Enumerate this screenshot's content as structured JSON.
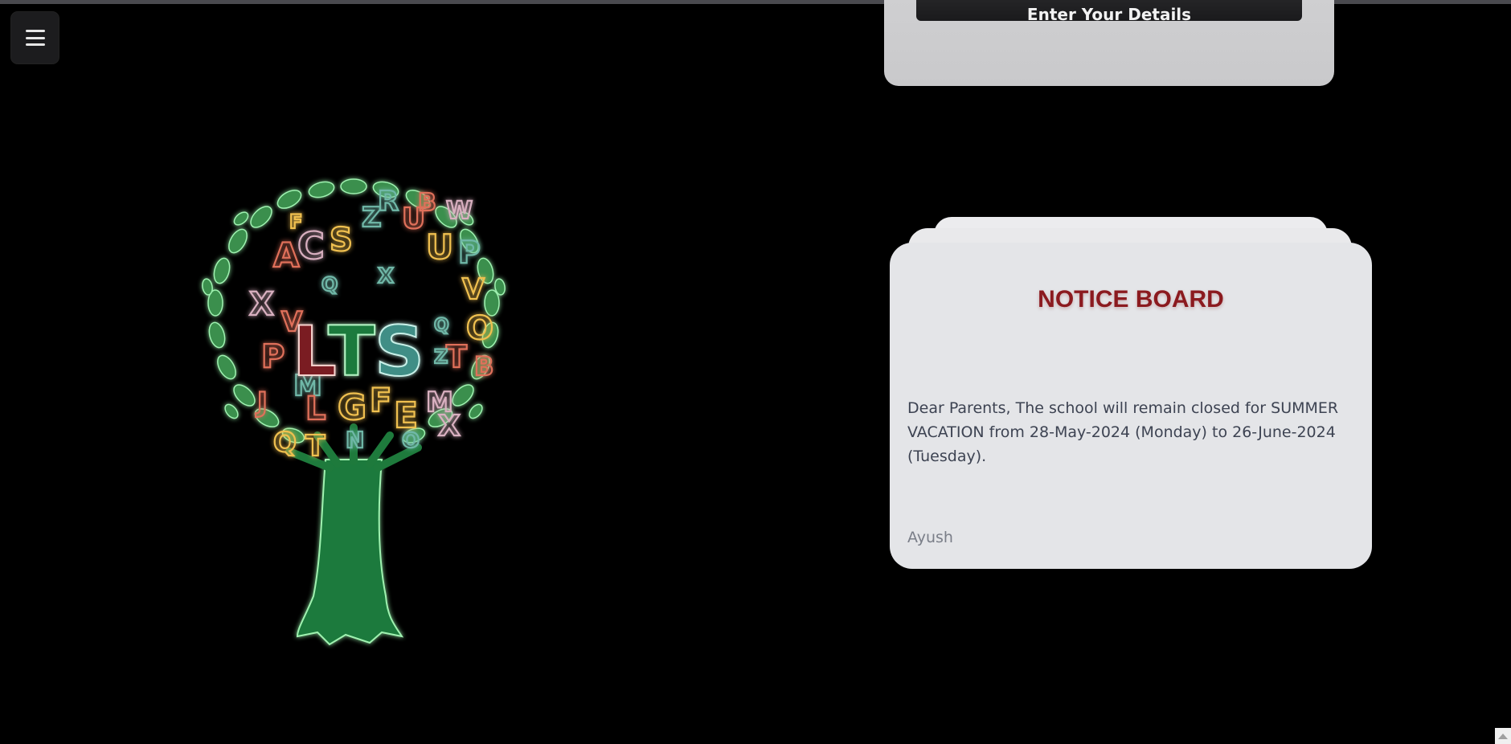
{
  "header": {
    "menu_icon": "hamburger-menu-icon"
  },
  "logo": {
    "text": "LTS",
    "icon": "tree-logo-icon",
    "colors": {
      "leaf": "#3a8f4e",
      "trunk": "#1e7a3c",
      "glow": "#9ff2b0",
      "letter_red": "#e0705a",
      "letter_yellow": "#f0c050",
      "letter_teal": "#6fb8a8"
    }
  },
  "form": {
    "button_label": "Enter Your Details"
  },
  "notice": {
    "title": "NOTICE BOARD",
    "body": "Dear Parents, The school will remain closed for SUMMER VACATION from 28-May-2024 (Monday) to 26-June-2024 (Tuesday).",
    "author": "Ayush",
    "title_color": "#8b1a1f"
  },
  "scrollbar": {
    "icon": "scroll-up-arrow-icon"
  }
}
